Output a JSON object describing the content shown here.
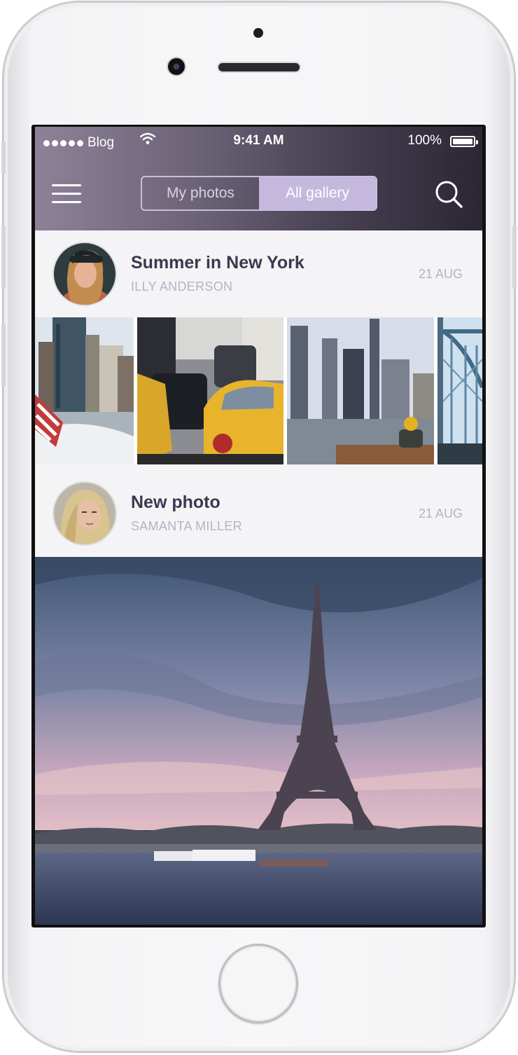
{
  "status_bar": {
    "carrier": "Blog",
    "time": "9:41 AM",
    "battery": "100%"
  },
  "nav": {
    "menu_icon": "hamburger-menu-icon",
    "tabs": [
      {
        "label": "My photos",
        "active": false
      },
      {
        "label": "All gallery",
        "active": true
      }
    ],
    "search_icon": "search-icon"
  },
  "posts": [
    {
      "title": "Summer in New York",
      "author": "ILLY ANDERSON",
      "date": "21 AUG",
      "photos": [
        "city-skyline-photo",
        "yellow-taxi-photo",
        "riverside-skyline-photo",
        "bridge-photo"
      ]
    },
    {
      "title": "New photo",
      "author": "SAMANTA MILLER",
      "date": "21 AUG",
      "photos": [
        "eiffel-tower-photo"
      ]
    }
  ],
  "colors": {
    "accent": "#c4b9dd",
    "header_dark": "#2b2633",
    "title_text": "#3d3750",
    "muted_text": "#b7b2c3"
  }
}
